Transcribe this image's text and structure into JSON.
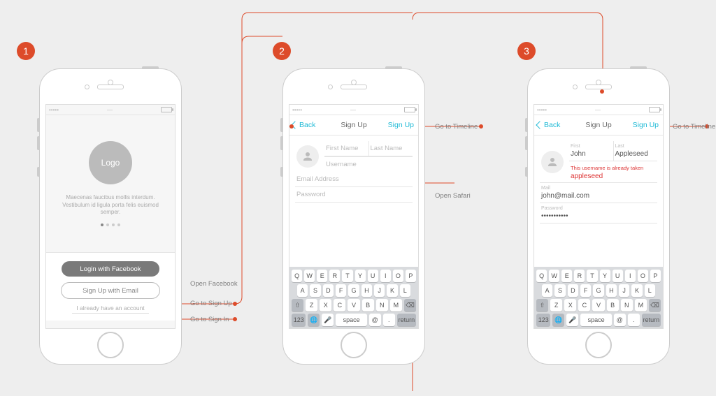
{
  "badges": [
    "1",
    "2",
    "3"
  ],
  "screen1": {
    "logo": "Logo",
    "tagline": "Maecenas faucibus mollis interdum. Vestibulum id ligula porta felis euismod semper.",
    "facebook_btn": "Login with Facebook",
    "email_btn": "Sign Up with Email",
    "already": "I already have an account"
  },
  "nav": {
    "back": "Back",
    "title": "Sign Up",
    "done": "Sign Up"
  },
  "screen2": {
    "first_ph": "First Name",
    "last_ph": "Last Name",
    "user_ph": "Username",
    "email_ph": "Email Address",
    "pass_ph": "Password"
  },
  "screen3": {
    "first_lbl": "First",
    "first_val": "John",
    "last_lbl": "Last",
    "last_val": "Appleseed",
    "err_msg": "This username is already taken",
    "user_val": "appleseed",
    "email_lbl": "Mail",
    "email_val": "john@mail.com",
    "pass_lbl": "Password",
    "pass_val": "•••••••••••"
  },
  "keyboard": {
    "r1": [
      "Q",
      "W",
      "E",
      "R",
      "T",
      "Y",
      "U",
      "I",
      "O",
      "P"
    ],
    "r2": [
      "A",
      "S",
      "D",
      "F",
      "G",
      "H",
      "J",
      "K",
      "L"
    ],
    "r3_shift": "⇧",
    "r3": [
      "Z",
      "X",
      "C",
      "V",
      "B",
      "N",
      "M"
    ],
    "r3_del": "⌫",
    "r4_num": "123",
    "r4_globe": "🌐",
    "r4_mic": "🎤",
    "r4_space": "space",
    "r4_at": "@",
    "r4_dot": ".",
    "r4_return": "return"
  },
  "annotations": {
    "open_facebook": "Open Facebook",
    "goto_signup": "Go to Sign Up",
    "goto_signin": "Go to Sign In",
    "goto_timeline": "Go to Timeline",
    "open_safari": "Open Safari"
  }
}
